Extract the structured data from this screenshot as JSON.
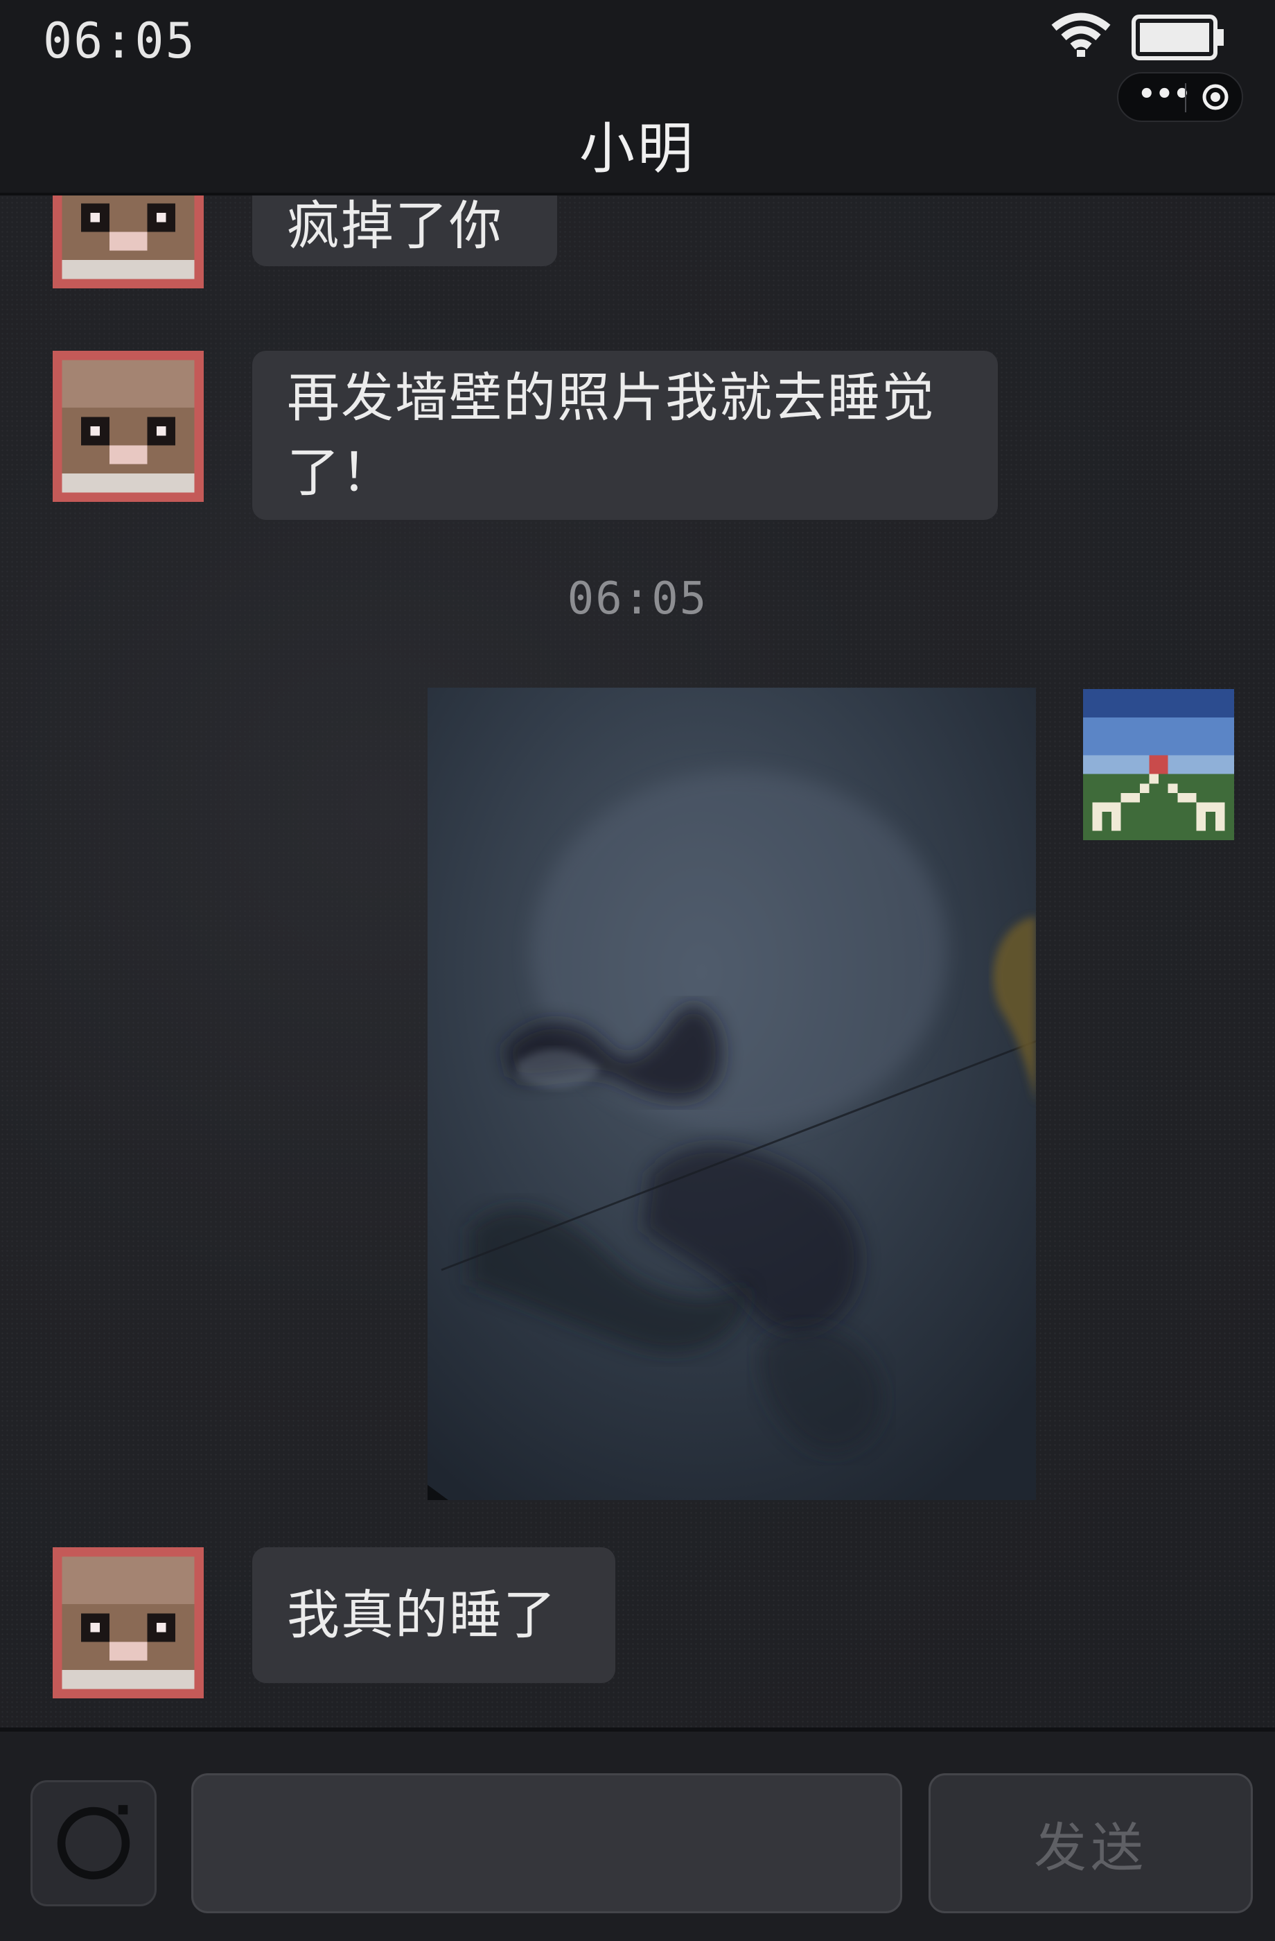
{
  "status_bar": {
    "time": "06:05",
    "wifi_icon": "wifi-icon",
    "battery_icon": "battery-icon"
  },
  "capsule": {
    "more_label": "•••",
    "more_icon": "more-dots-icon",
    "close_icon": "target-close-icon"
  },
  "header": {
    "title": "小明"
  },
  "messages": [
    {
      "sender": "contact",
      "type": "text",
      "text": "疯掉了你"
    },
    {
      "sender": "contact",
      "type": "text",
      "text": "再发墙壁的照片我就去睡觉了！"
    },
    {
      "type": "timestamp",
      "text": "06:05"
    },
    {
      "sender": "self",
      "type": "image",
      "image_desc": "wall-photo"
    },
    {
      "sender": "contact",
      "type": "text",
      "text": "我真的睡了"
    }
  ],
  "input_bar": {
    "camera_icon": "camera-icon",
    "input_value": "",
    "input_placeholder": "",
    "send_label": "发送"
  },
  "colors": {
    "background": "#1c1d21",
    "bubble": "#35363b",
    "avatar_border": "#c45a58",
    "send_disabled_text": "#5f6065"
  }
}
